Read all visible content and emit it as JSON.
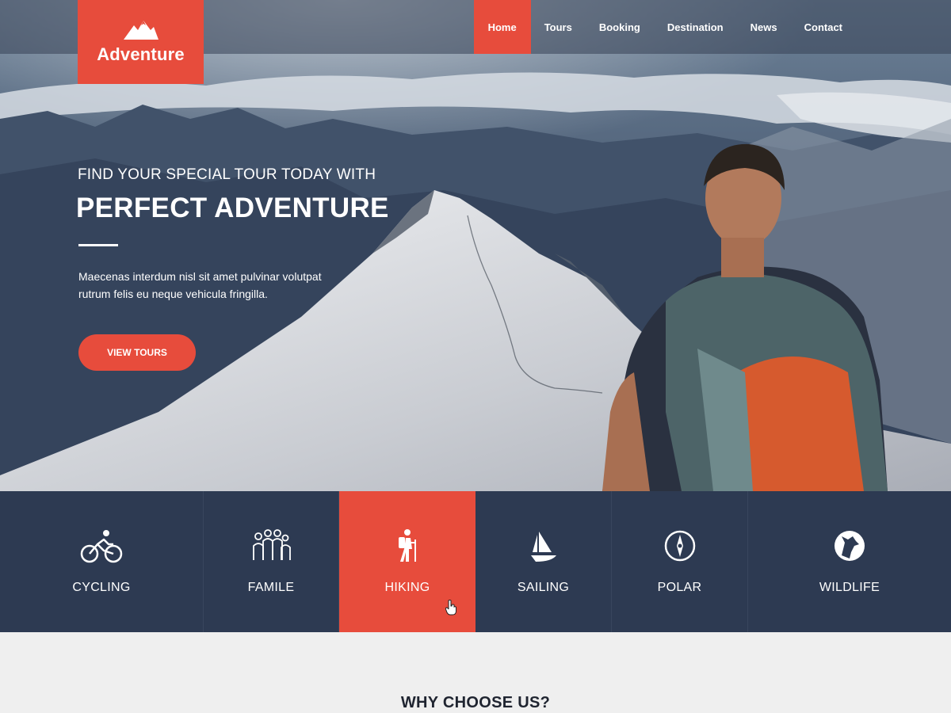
{
  "brand": {
    "name": "Adventure",
    "accent": "#e74c3c",
    "dark": "#2d3a52"
  },
  "nav": {
    "items": [
      {
        "label": "Home",
        "active": true
      },
      {
        "label": "Tours",
        "active": false
      },
      {
        "label": "Booking",
        "active": false
      },
      {
        "label": "Destination",
        "active": false
      },
      {
        "label": "News",
        "active": false
      },
      {
        "label": "Contact",
        "active": false
      }
    ]
  },
  "hero": {
    "subtitle": "FIND YOUR SPECIAL TOUR TODAY WITH",
    "title": "PERFECT ADVENTURE",
    "description": "Maecenas interdum nisl sit amet pulvinar volutpat rutrum felis eu neque vehicula fringilla.",
    "button_label": "VIEW TOURS",
    "image": "mountain-hiker-photo"
  },
  "categories": [
    {
      "label": "CYCLING",
      "icon": "cyclist-icon",
      "active": false
    },
    {
      "label": "FAMILE",
      "icon": "family-icon",
      "active": false
    },
    {
      "label": "HIKING",
      "icon": "hiker-icon",
      "active": true
    },
    {
      "label": "SAILING",
      "icon": "sailboat-icon",
      "active": false
    },
    {
      "label": "POLAR",
      "icon": "compass-icon",
      "active": false
    },
    {
      "label": "WILDLIFE",
      "icon": "wolf-icon",
      "active": false
    }
  ],
  "section": {
    "title": "WHY CHOOSE US?"
  }
}
